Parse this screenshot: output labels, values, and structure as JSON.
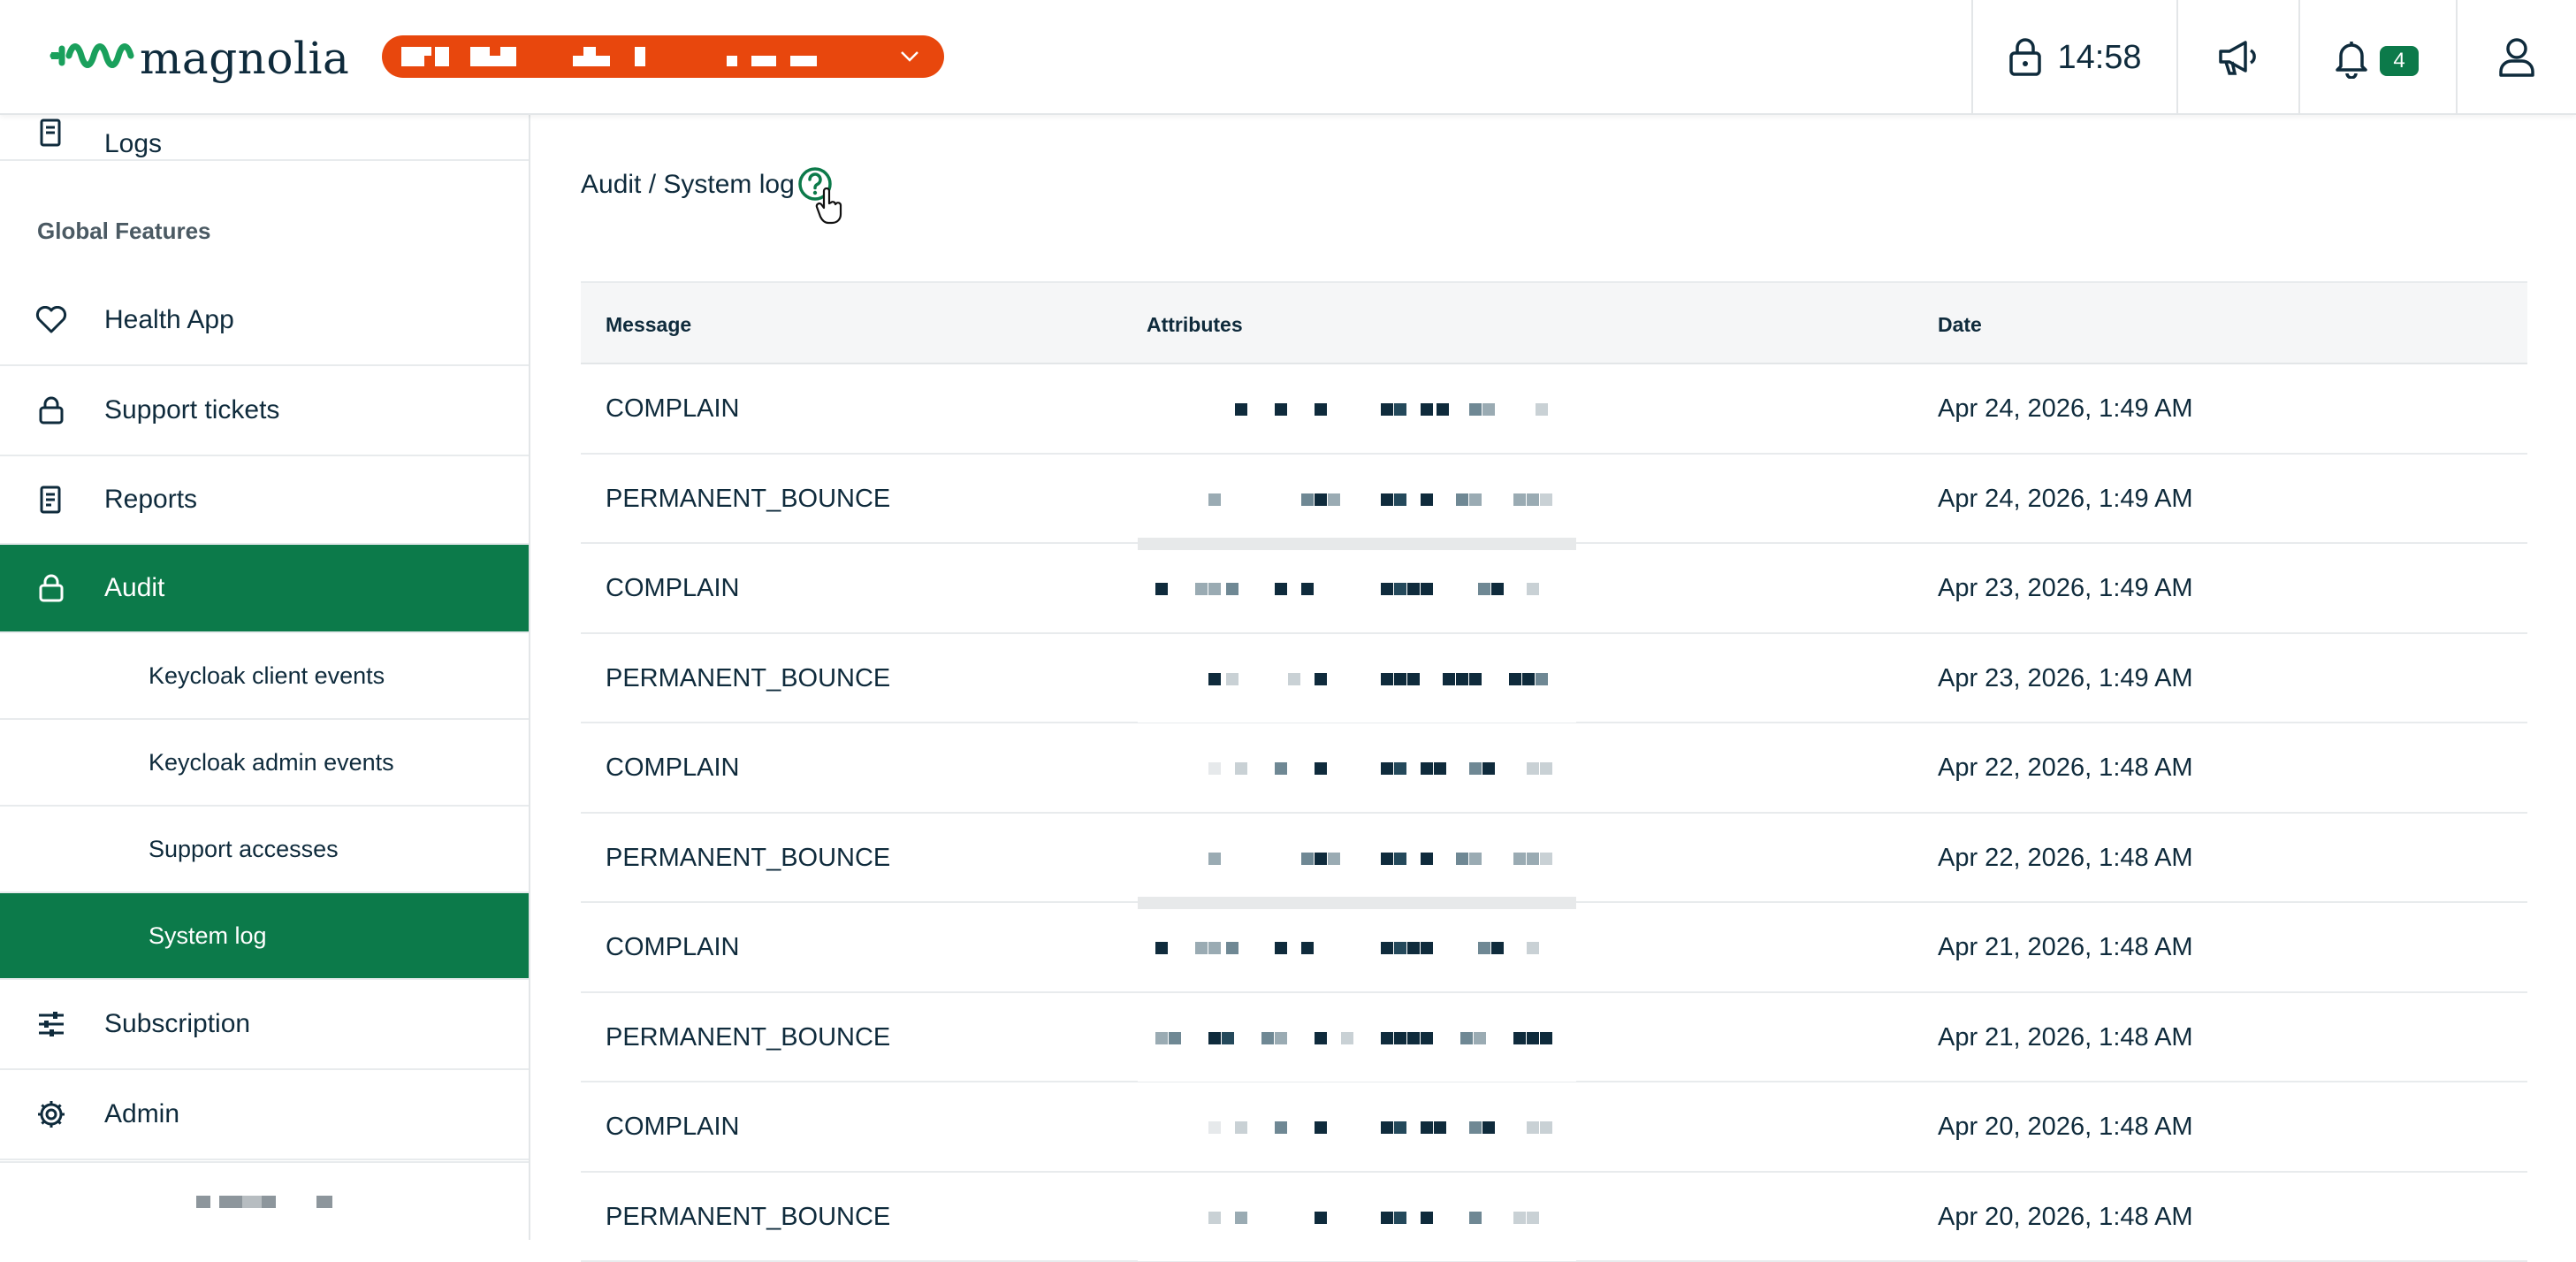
{
  "brand": {
    "name": "magnolia"
  },
  "colors": {
    "accent_green": "#0c7a4a",
    "env_orange": "#e8470d",
    "text_dark": "#0f2b3c"
  },
  "topbar": {
    "session_time": "14:58",
    "notification_count": "4",
    "icons": [
      "lock-icon",
      "megaphone-icon",
      "bell-icon",
      "user-icon"
    ]
  },
  "sidebar": {
    "partial_item": {
      "label": "Logs",
      "icon": "document-icon"
    },
    "section_title": "Global Features",
    "items": [
      {
        "label": "Health App",
        "icon": "heart-icon"
      },
      {
        "label": "Support tickets",
        "icon": "lock-icon"
      },
      {
        "label": "Reports",
        "icon": "report-icon"
      },
      {
        "label": "Audit",
        "icon": "lock-icon",
        "active": true
      },
      {
        "label": "Keycloak client events"
      },
      {
        "label": "Keycloak admin events"
      },
      {
        "label": "Support accesses"
      },
      {
        "label": "System log",
        "active": true
      },
      {
        "label": "Subscription",
        "icon": "sliders-icon"
      },
      {
        "label": "Admin",
        "icon": "gear-icon"
      }
    ]
  },
  "main": {
    "breadcrumb": "Audit / System log",
    "table": {
      "columns": [
        "Message",
        "Attributes",
        "Date"
      ],
      "rows": [
        {
          "message": "COMPLAIN",
          "date": "Apr 24, 2026, 1:49 AM"
        },
        {
          "message": "PERMANENT_BOUNCE",
          "date": "Apr 24, 2026, 1:49 AM"
        },
        {
          "message": "COMPLAIN",
          "date": "Apr 23, 2026, 1:49 AM"
        },
        {
          "message": "PERMANENT_BOUNCE",
          "date": "Apr 23, 2026, 1:49 AM"
        },
        {
          "message": "COMPLAIN",
          "date": "Apr 22, 2026, 1:48 AM"
        },
        {
          "message": "PERMANENT_BOUNCE",
          "date": "Apr 22, 2026, 1:48 AM"
        },
        {
          "message": "COMPLAIN",
          "date": "Apr 21, 2026, 1:48 AM"
        },
        {
          "message": "PERMANENT_BOUNCE",
          "date": "Apr 21, 2026, 1:48 AM"
        },
        {
          "message": "COMPLAIN",
          "date": "Apr 20, 2026, 1:48 AM"
        },
        {
          "message": "PERMANENT_BOUNCE",
          "date": "Apr 20, 2026, 1:48 AM"
        }
      ]
    }
  }
}
